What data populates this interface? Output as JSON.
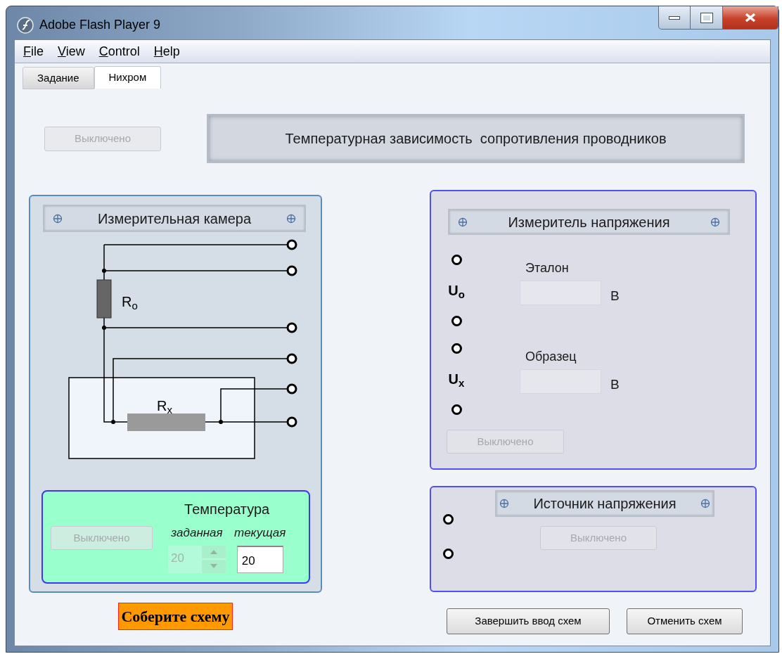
{
  "window": {
    "title": "Adobe Flash Player 9"
  },
  "menu": [
    {
      "label": "File"
    },
    {
      "label": "View"
    },
    {
      "label": "Control"
    },
    {
      "label": "Help"
    }
  ],
  "tabs": [
    {
      "label": "Задание",
      "selected": false
    },
    {
      "label": "Нихром",
      "selected": true
    }
  ],
  "power_button": {
    "label": "Выключено",
    "disabled": true
  },
  "banner": {
    "title": "Температурная зависимость  сопротивления проводников"
  },
  "measuring_chamber": {
    "title": "Измерительная камера",
    "resistors": [
      {
        "label": "R$_{o}$"
      },
      {
        "label": "R$_{x}$"
      }
    ],
    "temperature": {
      "title": "Температура",
      "button": {
        "label": "Выключено",
        "disabled": true
      },
      "set_label": "заданная",
      "set_value": "20",
      "set_disabled": true,
      "current_label": "текущая",
      "current_value": "20"
    }
  },
  "status_label": "Соберите схему",
  "voltmeter": {
    "title": "Измеритель напряжения",
    "channels": [
      {
        "symbol": "U$_{o}$",
        "label": "Эталон",
        "unit": "В"
      },
      {
        "symbol": "U$_{x}$",
        "label": "Образец",
        "unit": "В"
      }
    ],
    "button": {
      "label": "Выключено",
      "disabled": true
    }
  },
  "source": {
    "title": "Источник напряжения",
    "button": {
      "label": "Выключено",
      "disabled": true
    }
  },
  "actions": [
    {
      "label": "Завершить ввод схем"
    },
    {
      "label": "Отменить схем"
    }
  ]
}
